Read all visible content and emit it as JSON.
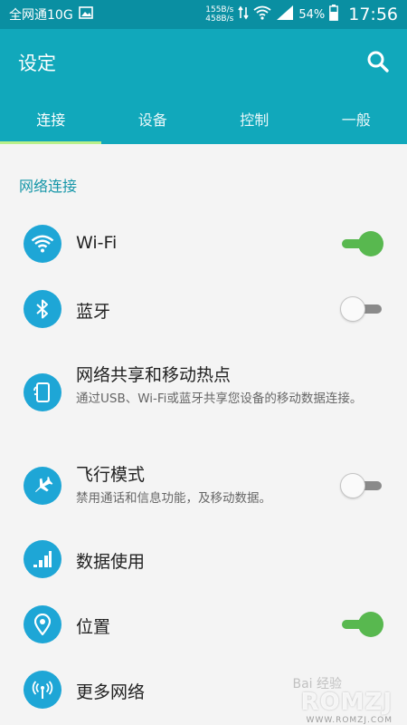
{
  "status_bar": {
    "carrier": "全网通10G",
    "speed_up": "155B/s",
    "speed_down": "458B/s",
    "battery_percent": "54%",
    "time": "17:56"
  },
  "app": {
    "title": "设定"
  },
  "tabs": [
    {
      "label": "连接",
      "active": true
    },
    {
      "label": "设备",
      "active": false
    },
    {
      "label": "控制",
      "active": false
    },
    {
      "label": "一般",
      "active": false
    }
  ],
  "section": {
    "title": "网络连接"
  },
  "items": [
    {
      "title": "Wi-Fi",
      "subtitle": "",
      "icon": "wifi-icon",
      "toggle": "on"
    },
    {
      "title": "蓝牙",
      "subtitle": "",
      "icon": "bluetooth-icon",
      "toggle": "off"
    },
    {
      "title": "网络共享和移动热点",
      "subtitle": "通过USB、Wi-Fi或蓝牙共享您设备的移动数据连接。",
      "icon": "tethering-icon",
      "toggle": "none"
    },
    {
      "title": "飞行模式",
      "subtitle": "禁用通话和信息功能，及移动数据。",
      "icon": "airplane-icon",
      "toggle": "off"
    },
    {
      "title": "数据使用",
      "subtitle": "",
      "icon": "data-usage-icon",
      "toggle": "none"
    },
    {
      "title": "位置",
      "subtitle": "",
      "icon": "location-icon",
      "toggle": "on"
    },
    {
      "title": "更多网络",
      "subtitle": "",
      "icon": "more-networks-icon",
      "toggle": "none"
    }
  ],
  "watermark": {
    "brand": "ROMZJ",
    "url": "WWW.ROMZJ.COM",
    "baidu": "Bai 经验"
  },
  "colors": {
    "status_bar": "#0a8fa2",
    "app_bar": "#11a8bb",
    "tab_indicator": "#b9f08a",
    "icon_circle": "#1ea6d6",
    "toggle_on": "#58b84f",
    "section_header": "#1596a8"
  }
}
